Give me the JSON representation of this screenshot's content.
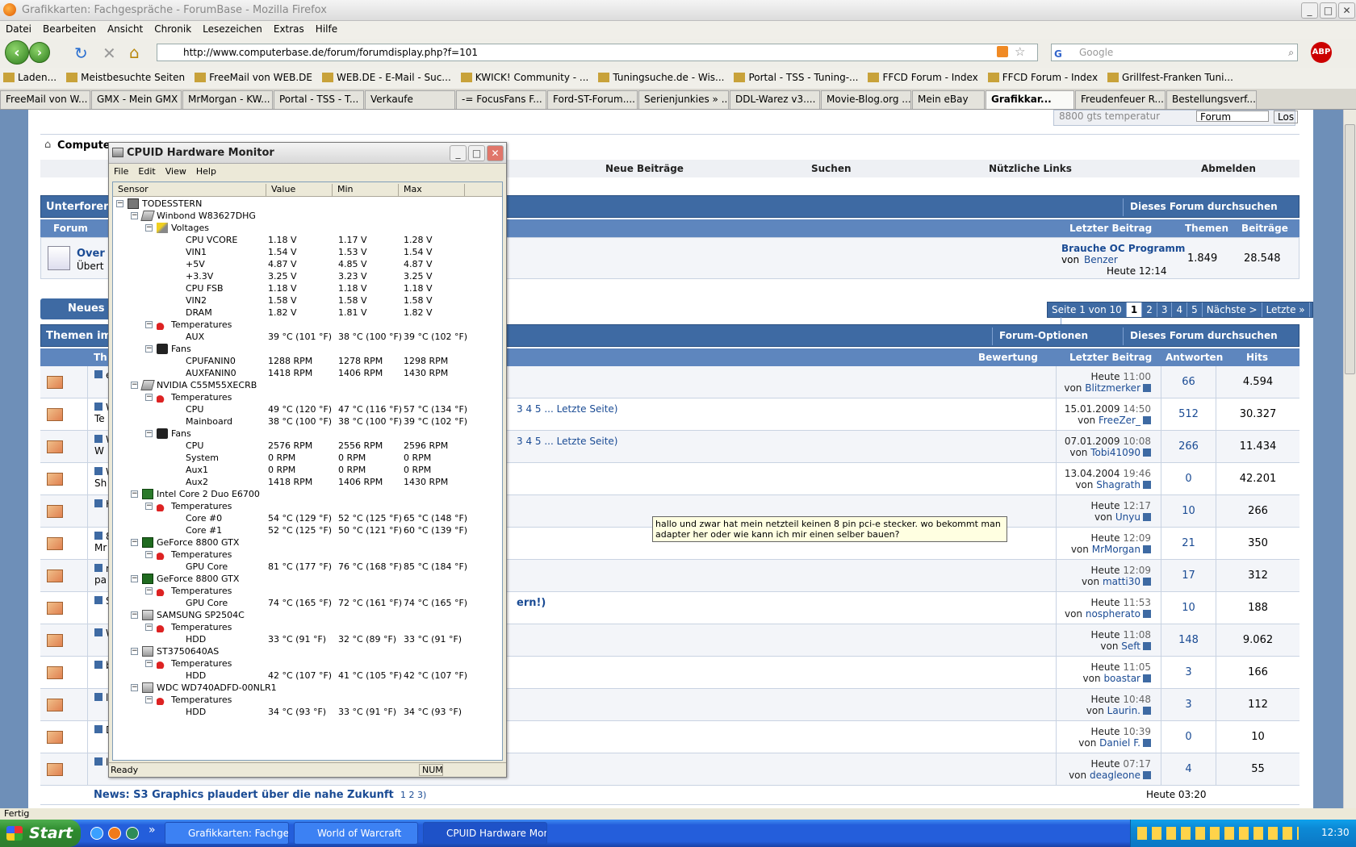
{
  "firefox": {
    "window_title": "Grafikkarten: Fachgespräche - ForumBase - Mozilla Firefox",
    "menu": [
      "Datei",
      "Bearbeiten",
      "Ansicht",
      "Chronik",
      "Lesezeichen",
      "Extras",
      "Hilfe"
    ],
    "url": "http://www.computerbase.de/forum/forumdisplay.php?f=101",
    "search_placeholder": "Google",
    "bookmarks": [
      "Laden...",
      "Meistbesuchte Seiten",
      "FreeMail von WEB.DE",
      "WEB.DE - E-Mail - Suc...",
      "KWICK! Community - ...",
      "Tuningsuche.de - Wis...",
      "Portal - TSS - Tuning-...",
      "FFCD Forum - Index",
      "FFCD Forum - Index",
      "Grillfest-Franken Tuni..."
    ],
    "tabs": [
      "FreeMail von W...",
      "GMX - Mein GMX",
      "MrMorgan - KW...",
      "Portal - TSS - T...",
      "Verkaufe",
      "-= FocusFans F...",
      "Ford-ST-Forum....",
      "Serienjunkies » ...",
      "DDL-Warez v3....",
      "Movie-Blog.org ...",
      "Mein eBay",
      "Grafikkar...",
      "Freudenfeuer R...",
      "Bestellungsverf..."
    ],
    "active_tab": "Grafikkar...",
    "status": "Fertig"
  },
  "forum": {
    "breadcrumb": "Computer",
    "nav": [
      "Neue Beiträge",
      "Suchen",
      "Nützliche Links",
      "Abmelden"
    ],
    "search_box": "8800 gts temperatur",
    "search_scope": "Forum",
    "search_go": "Los",
    "subforum_header": "Unterforen",
    "search_forum": "Dieses Forum durchsuchen",
    "col_forum": "Forum",
    "col_last": "Letzter Beitrag",
    "col_themen": "Themen",
    "col_beitraege": "Beiträge",
    "subforum": {
      "title": "Over",
      "desc": "Übert",
      "last_title": "Brauche OC Programm",
      "last_by": "von",
      "last_user": "Benzer",
      "last_time": "Heute 12:14",
      "themen": "1.849",
      "beitraege": "28.548"
    },
    "new_thread": "Neues T",
    "pager": [
      "Seite 1 von 10",
      "1",
      "2",
      "3",
      "4",
      "5",
      "Nächste >",
      "Letzte »"
    ],
    "threads_header": "Themen im",
    "forum_options": "Forum-Optionen",
    "col_th": "Th",
    "col_bewertung": "Bewertung",
    "col_antworten": "Antworten",
    "col_hits": "Hits",
    "threads": [
      {
        "snip": "ele",
        "date": "Heute",
        "time": "11:00",
        "user": "Blitzmerker",
        "answers": "66",
        "hits": "4.594"
      },
      {
        "snip": "W",
        "snip2": "Te",
        "pages": "3 4 5 ... Letzte Seite)",
        "date": "15.01.2009",
        "time": "14:50",
        "user": "FreeZer_",
        "answers": "512",
        "hits": "30.327"
      },
      {
        "snip": "W",
        "snip2": "W",
        "pages": "3 4 5 ... Letzte Seite)",
        "date": "07.01.2009",
        "time": "10:08",
        "user": "Tobi41090",
        "answers": "266",
        "hits": "11.434"
      },
      {
        "snip": "W",
        "snip2": "Sh",
        "date": "13.04.2004",
        "time": "19:46",
        "user": "Shagrath",
        "answers": "0",
        "hits": "42.201"
      },
      {
        "snip": "Ho",
        "date": "Heute",
        "time": "12:17",
        "user": "Unyu",
        "answers": "10",
        "hits": "266"
      },
      {
        "snip": "88",
        "snip2": "Mr",
        "date": "Heute",
        "time": "12:09",
        "user": "MrMorgan",
        "answers": "21",
        "hits": "350"
      },
      {
        "snip": "nv",
        "snip2": "pa",
        "date": "Heute",
        "time": "12:09",
        "user": "matti30",
        "answers": "17",
        "hits": "312"
      },
      {
        "snip": "Sc",
        "pages": "ern!)",
        "date": "Heute",
        "time": "11:53",
        "user": "nospherato",
        "answers": "10",
        "hits": "188"
      },
      {
        "snip": "W",
        "date": "Heute",
        "time": "11:08",
        "user": "Seft",
        "answers": "148",
        "hits": "9.062"
      },
      {
        "snip": "bo",
        "date": "Heute",
        "time": "11:05",
        "user": "boastar",
        "answers": "3",
        "hits": "166"
      },
      {
        "snip": "l3l",
        "date": "Heute",
        "time": "10:48",
        "user": "Laurin.",
        "answers": "3",
        "hits": "112"
      },
      {
        "snip": "Da",
        "date": "Heute",
        "time": "10:39",
        "user": "Daniel F.",
        "answers": "0",
        "hits": "10"
      },
      {
        "snip": "langen1992",
        "date": "Heute",
        "time": "07:17",
        "user": "deagleone",
        "answers": "4",
        "hits": "55"
      }
    ],
    "last_thread_title": "News: S3 Graphics plaudert über die nahe Zukunft",
    "last_thread_pages": "1 2 3)",
    "last_thread_date": "Heute 03:20",
    "von": "von",
    "tooltip": "hallo und zwar hat mein netzteil keinen 8 pin pci-e stecker. wo bekommt man adapter her oder wie kann ich mir einen selber bauen?"
  },
  "hwmon": {
    "title": "CPUID Hardware Monitor",
    "menu": [
      "File",
      "Edit",
      "View",
      "Help"
    ],
    "columns": [
      "Sensor",
      "Value",
      "Min",
      "Max"
    ],
    "rows": [
      {
        "level": 0,
        "icon": "computer-icon",
        "box": "−",
        "label": "TODESSTERN"
      },
      {
        "level": 1,
        "icon": "chip-icon",
        "box": "−",
        "label": "Winbond W83627DHG"
      },
      {
        "level": 2,
        "icon": "voltage-icon",
        "box": "−",
        "label": "Voltages"
      },
      {
        "level": 3,
        "label": "CPU VCORE",
        "value": "1.18 V",
        "min": "1.17 V",
        "max": "1.28 V"
      },
      {
        "level": 3,
        "label": "VIN1",
        "value": "1.54 V",
        "min": "1.53 V",
        "max": "1.54 V"
      },
      {
        "level": 3,
        "label": "+5V",
        "value": "4.87 V",
        "min": "4.85 V",
        "max": "4.87 V"
      },
      {
        "level": 3,
        "label": "+3.3V",
        "value": "3.25 V",
        "min": "3.23 V",
        "max": "3.25 V"
      },
      {
        "level": 3,
        "label": "CPU FSB",
        "value": "1.18 V",
        "min": "1.18 V",
        "max": "1.18 V"
      },
      {
        "level": 3,
        "label": "VIN2",
        "value": "1.58 V",
        "min": "1.58 V",
        "max": "1.58 V"
      },
      {
        "level": 3,
        "label": "DRAM",
        "value": "1.82 V",
        "min": "1.81 V",
        "max": "1.82 V"
      },
      {
        "level": 2,
        "icon": "thermometer-icon",
        "box": "−",
        "label": "Temperatures"
      },
      {
        "level": 3,
        "label": "AUX",
        "value": "39 °C (101 °F)",
        "min": "38 °C (100 °F)",
        "max": "39 °C (102 °F)"
      },
      {
        "level": 2,
        "icon": "fan-icon",
        "box": "−",
        "label": "Fans"
      },
      {
        "level": 3,
        "label": "CPUFANIN0",
        "value": "1288 RPM",
        "min": "1278 RPM",
        "max": "1298 RPM"
      },
      {
        "level": 3,
        "label": "AUXFANIN0",
        "value": "1418 RPM",
        "min": "1406 RPM",
        "max": "1430 RPM"
      },
      {
        "level": 1,
        "icon": "chip-icon",
        "box": "−",
        "label": "NVIDIA C55M55XECRB"
      },
      {
        "level": 2,
        "icon": "thermometer-icon",
        "box": "−",
        "label": "Temperatures"
      },
      {
        "level": 3,
        "label": "CPU",
        "value": "49 °C (120 °F)",
        "min": "47 °C (116 °F)",
        "max": "57 °C (134 °F)"
      },
      {
        "level": 3,
        "label": "Mainboard",
        "value": "38 °C (100 °F)",
        "min": "38 °C (100 °F)",
        "max": "39 °C (102 °F)"
      },
      {
        "level": 2,
        "icon": "fan-icon",
        "box": "−",
        "label": "Fans"
      },
      {
        "level": 3,
        "label": "CPU",
        "value": "2576 RPM",
        "min": "2556 RPM",
        "max": "2596 RPM"
      },
      {
        "level": 3,
        "label": "System",
        "value": "0 RPM",
        "min": "0 RPM",
        "max": "0 RPM"
      },
      {
        "level": 3,
        "label": "Aux1",
        "value": "0 RPM",
        "min": "0 RPM",
        "max": "0 RPM"
      },
      {
        "level": 3,
        "label": "Aux2",
        "value": "1418 RPM",
        "min": "1406 RPM",
        "max": "1430 RPM"
      },
      {
        "level": 1,
        "icon": "cpu-icon",
        "box": "−",
        "label": "Intel Core 2 Duo E6700"
      },
      {
        "level": 2,
        "icon": "thermometer-icon",
        "box": "−",
        "label": "Temperatures"
      },
      {
        "level": 3,
        "label": "Core #0",
        "value": "54 °C (129 °F)",
        "min": "52 °C (125 °F)",
        "max": "65 °C (148 °F)"
      },
      {
        "level": 3,
        "label": "Core #1",
        "value": "52 °C (125 °F)",
        "min": "50 °C (121 °F)",
        "max": "60 °C (139 °F)"
      },
      {
        "level": 1,
        "icon": "gpu-icon",
        "box": "−",
        "label": "GeForce 8800 GTX"
      },
      {
        "level": 2,
        "icon": "thermometer-icon",
        "box": "−",
        "label": "Temperatures"
      },
      {
        "level": 3,
        "label": "GPU Core",
        "value": "81 °C (177 °F)",
        "min": "76 °C (168 °F)",
        "max": "85 °C (184 °F)"
      },
      {
        "level": 1,
        "icon": "gpu-icon",
        "box": "−",
        "label": "GeForce 8800 GTX"
      },
      {
        "level": 2,
        "icon": "thermometer-icon",
        "box": "−",
        "label": "Temperatures"
      },
      {
        "level": 3,
        "label": "GPU Core",
        "value": "74 °C (165 °F)",
        "min": "72 °C (161 °F)",
        "max": "74 °C (165 °F)"
      },
      {
        "level": 1,
        "icon": "hdd-icon",
        "box": "−",
        "label": "SAMSUNG SP2504C"
      },
      {
        "level": 2,
        "icon": "thermometer-icon",
        "box": "−",
        "label": "Temperatures"
      },
      {
        "level": 3,
        "label": "HDD",
        "value": "33 °C (91 °F)",
        "min": "32 °C (89 °F)",
        "max": "33 °C (91 °F)"
      },
      {
        "level": 1,
        "icon": "hdd-icon",
        "box": "−",
        "label": "ST3750640AS"
      },
      {
        "level": 2,
        "icon": "thermometer-icon",
        "box": "−",
        "label": "Temperatures"
      },
      {
        "level": 3,
        "label": "HDD",
        "value": "42 °C (107 °F)",
        "min": "41 °C (105 °F)",
        "max": "42 °C (107 °F)"
      },
      {
        "level": 1,
        "icon": "hdd-icon",
        "box": "−",
        "label": "WDC WD740ADFD-00NLR1"
      },
      {
        "level": 2,
        "icon": "thermometer-icon",
        "box": "−",
        "label": "Temperatures"
      },
      {
        "level": 3,
        "label": "HDD",
        "value": "34 °C (93 °F)",
        "min": "33 °C (91 °F)",
        "max": "34 °C (93 °F)"
      }
    ],
    "status": "Ready",
    "num": "NUM"
  },
  "taskbar": {
    "start": "Start",
    "buttons": [
      "Grafikkarten: Fachge...",
      "World of Warcraft",
      "CPUID Hardware Mon..."
    ],
    "clock": "12:30"
  }
}
